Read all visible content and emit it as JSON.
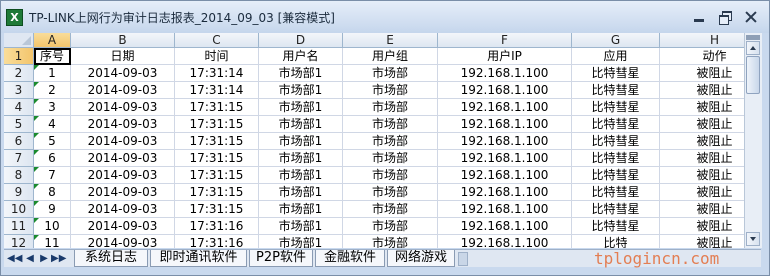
{
  "window": {
    "title": "TP-LINK上网行为审计日志报表_2014_09_03  [兼容模式]",
    "icon": "excel-icon",
    "icon_letter": "X"
  },
  "columns": [
    {
      "letter": "A",
      "header": "序号"
    },
    {
      "letter": "B",
      "header": "日期"
    },
    {
      "letter": "C",
      "header": "时间"
    },
    {
      "letter": "D",
      "header": "用户名"
    },
    {
      "letter": "E",
      "header": "用户组"
    },
    {
      "letter": "F",
      "header": "用户IP"
    },
    {
      "letter": "G",
      "header": "应用"
    },
    {
      "letter": "H",
      "header": "动作"
    }
  ],
  "header_row_number": "1",
  "rows": [
    {
      "num": "2",
      "cells": [
        "1",
        "2014-09-03",
        "17:31:14",
        "市场部1",
        "市场部",
        "192.168.1.100",
        "比特彗星",
        "被阻止"
      ]
    },
    {
      "num": "3",
      "cells": [
        "2",
        "2014-09-03",
        "17:31:14",
        "市场部1",
        "市场部",
        "192.168.1.100",
        "比特彗星",
        "被阻止"
      ]
    },
    {
      "num": "4",
      "cells": [
        "3",
        "2014-09-03",
        "17:31:15",
        "市场部1",
        "市场部",
        "192.168.1.100",
        "比特彗星",
        "被阻止"
      ]
    },
    {
      "num": "5",
      "cells": [
        "4",
        "2014-09-03",
        "17:31:15",
        "市场部1",
        "市场部",
        "192.168.1.100",
        "比特彗星",
        "被阻止"
      ]
    },
    {
      "num": "6",
      "cells": [
        "5",
        "2014-09-03",
        "17:31:15",
        "市场部1",
        "市场部",
        "192.168.1.100",
        "比特彗星",
        "被阻止"
      ]
    },
    {
      "num": "7",
      "cells": [
        "6",
        "2014-09-03",
        "17:31:15",
        "市场部1",
        "市场部",
        "192.168.1.100",
        "比特彗星",
        "被阻止"
      ]
    },
    {
      "num": "8",
      "cells": [
        "7",
        "2014-09-03",
        "17:31:15",
        "市场部1",
        "市场部",
        "192.168.1.100",
        "比特彗星",
        "被阻止"
      ]
    },
    {
      "num": "9",
      "cells": [
        "8",
        "2014-09-03",
        "17:31:15",
        "市场部1",
        "市场部",
        "192.168.1.100",
        "比特彗星",
        "被阻止"
      ]
    },
    {
      "num": "10",
      "cells": [
        "9",
        "2014-09-03",
        "17:31:15",
        "市场部1",
        "市场部",
        "192.168.1.100",
        "比特彗星",
        "被阻止"
      ]
    },
    {
      "num": "11",
      "cells": [
        "10",
        "2014-09-03",
        "17:31:16",
        "市场部1",
        "市场部",
        "192.168.1.100",
        "比特彗星",
        "被阻止"
      ]
    },
    {
      "num": "12",
      "cells": [
        "11",
        "2014-09-03",
        "17:31:16",
        "市场部1",
        "市场部",
        "192.168.1.100",
        "比特",
        "被阻止"
      ]
    }
  ],
  "selected_cell": "A1",
  "sheet_tabs": [
    "系统日志",
    "即时通讯软件",
    "P2P软件",
    "金融软件",
    "网络游戏"
  ],
  "tab_nav": {
    "first": "◀◀",
    "prev": "◀",
    "next": "▶",
    "last": "▶▶"
  },
  "watermark": "tplogincn.com"
}
